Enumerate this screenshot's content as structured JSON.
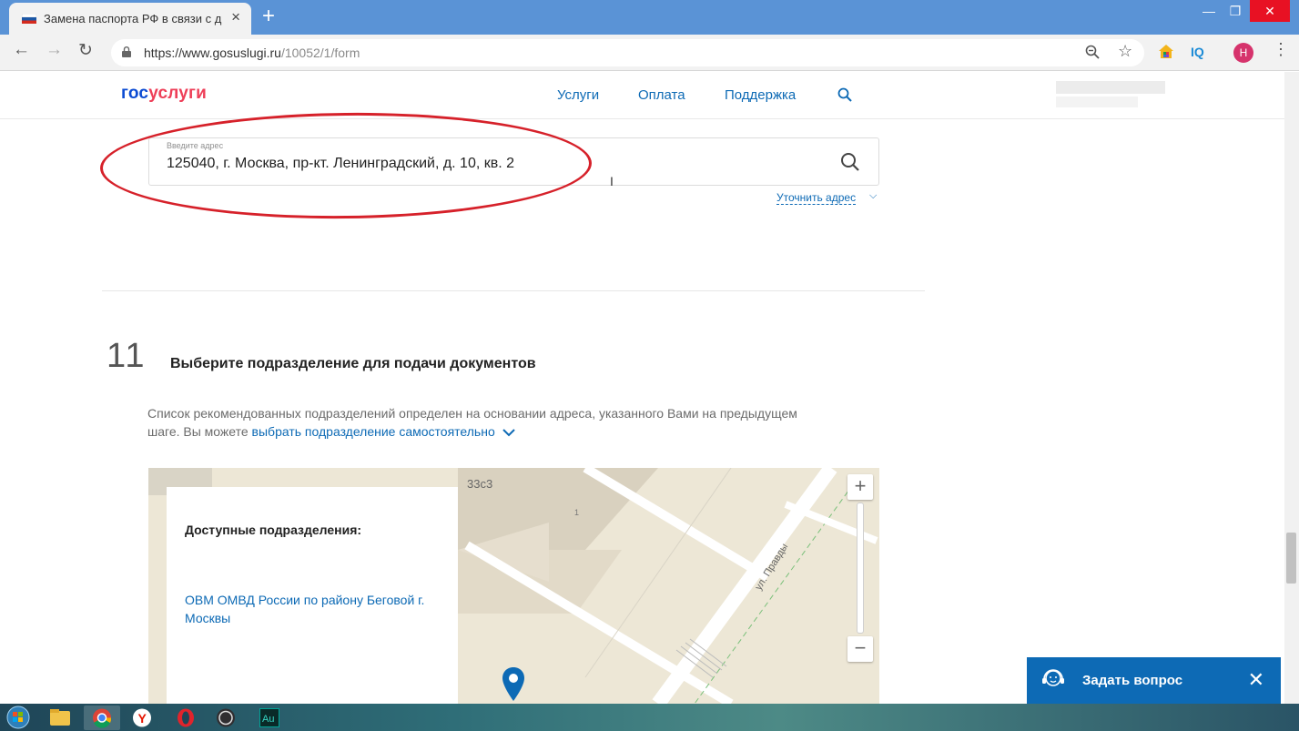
{
  "browser": {
    "tab_title": "Замена паспорта РФ в связи с д",
    "url_host": "https://www.gosuslugi.ru",
    "url_path": "/10052/1/form",
    "profile_initial": "Н",
    "iq_label": "IQ"
  },
  "site": {
    "logo_part1": "гос",
    "logo_part2": "услуги",
    "nav": [
      "Услуги",
      "Оплата",
      "Поддержка"
    ]
  },
  "address": {
    "label": "Введите адрес",
    "value": "125040, г. Москва, пр-кт. Ленинградский, д. 10, кв. 2",
    "refine_link": "Уточнить адрес"
  },
  "step": {
    "number": "11",
    "title": "Выберите подразделение для подачи документов",
    "text_line1": "Список рекомендованных подразделений определен на основании адреса, указанного Вами на предыдущем",
    "text_line2_prefix": "шаге. Вы можете ",
    "text_line2_link": "выбрать подразделение самостоятельно"
  },
  "map": {
    "building_label": "33с3",
    "street_label": "ул. Правды",
    "house_label": "1",
    "zoom_in": "+",
    "zoom_out": "−",
    "units_header": "Доступные подразделения:",
    "unit_name": "ОВМ ОМВД России по району Беговой г. Москвы"
  },
  "chat": {
    "label": "Задать вопрос"
  },
  "colors": {
    "accent": "#0d6ab5",
    "logo_blue": "#0d4cd3",
    "logo_red": "#ee3f58",
    "highlight": "#d6212a"
  }
}
